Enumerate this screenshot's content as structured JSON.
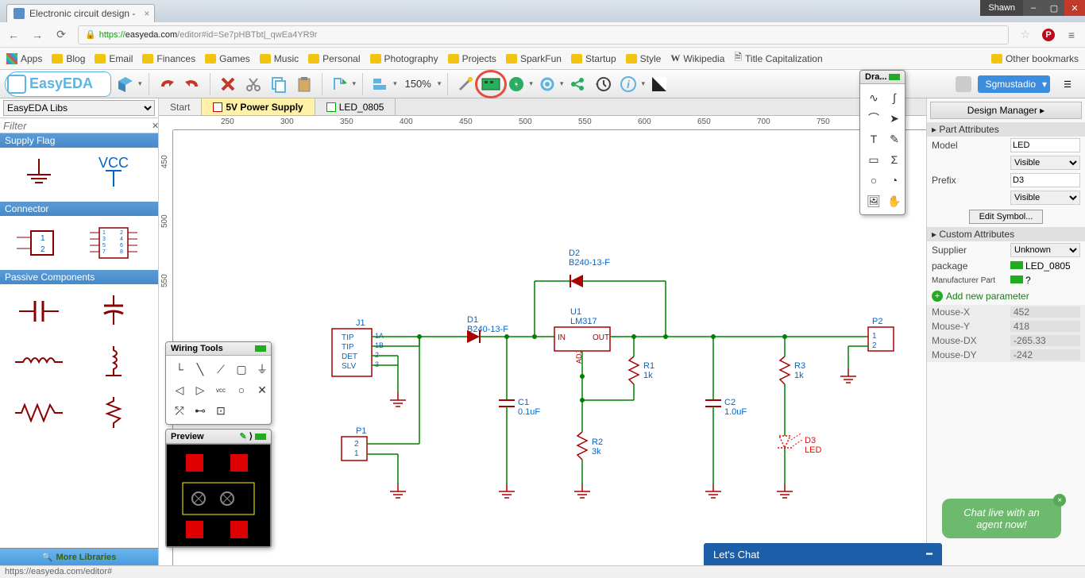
{
  "browser": {
    "tab_title": "Electronic circuit design -",
    "user": "Shawn",
    "url_prefix": "https://",
    "url_host": "easyeda.com",
    "url_path": "/editor#id=Se7pHBTbt|_qwEa4YR9r"
  },
  "bookmarks": {
    "apps": "Apps",
    "items": [
      "Blog",
      "Email",
      "Finances",
      "Games",
      "Music",
      "Personal",
      "Photography",
      "Projects",
      "SparkFun",
      "Startup",
      "Style",
      "Wikipedia",
      "Title Capitalization"
    ],
    "other": "Other bookmarks"
  },
  "toolbar": {
    "zoom": "150%",
    "user": "Sgmustadio"
  },
  "libs": {
    "title": "EasyEDA Libs",
    "filter_placeholder": "Filter",
    "sections": {
      "supply": "Supply Flag",
      "connector": "Connector",
      "passive": "Passive Components"
    },
    "gnd_label": "",
    "vcc_label": "VCC",
    "more": "More Libraries"
  },
  "doc_tabs": {
    "start": "Start",
    "supply": "5V Power Supply",
    "led": "LED_0805"
  },
  "ruler_h": [
    "250",
    "300",
    "350",
    "400",
    "450",
    "500",
    "550",
    "600",
    "650",
    "700",
    "750"
  ],
  "ruler_v": [
    "450",
    "500",
    "550"
  ],
  "schematic": {
    "J1": "J1",
    "J1_pins": [
      "TIP",
      "TIP",
      "DET",
      "SLV"
    ],
    "J1_nums": [
      "1A",
      "1B",
      "2",
      "3"
    ],
    "D1": "D1",
    "D1_val": "B240-13-F",
    "D2": "D2",
    "D2_val": "B240-13-F",
    "U1": "U1",
    "U1_val": "LM317",
    "U1_in": "IN",
    "U1_out": "OUT",
    "U1_adj": "ADJ",
    "C1": "C1",
    "C1_val": "0.1uF",
    "C2": "C2",
    "C2_val": "1.0uF",
    "R1": "R1",
    "R1_val": "1k",
    "R2": "R2",
    "R2_val": "3k",
    "R3": "R3",
    "R3_val": "1k",
    "D3": "D3",
    "D3_val": "LED",
    "P1": "P1",
    "P1_pins": [
      "2",
      "1"
    ],
    "P2": "P2",
    "P2_pins": [
      "1",
      "2"
    ]
  },
  "wiring_tools": {
    "title": "Wiring Tools"
  },
  "drawing_tools": {
    "title": "Dra..."
  },
  "preview": {
    "title": "Preview"
  },
  "rpanel": {
    "design_mgr": "Design Manager ▸",
    "part_attrs": "▸ Part Attributes",
    "model_label": "Model",
    "model_val": "LED",
    "visible1": "Visible",
    "prefix_label": "Prefix",
    "prefix_val": "D3",
    "visible2": "Visible",
    "edit_symbol": "Edit Symbol...",
    "custom_attrs": "▸ Custom Attributes",
    "supplier_label": "Supplier",
    "supplier_val": "Unknown",
    "package_label": "package",
    "package_val": "LED_0805",
    "mfr_label": "Manufacturer Part",
    "mfr_val": "?",
    "add_param": "Add new parameter",
    "mouse_x_l": "Mouse-X",
    "mouse_x": "452",
    "mouse_y_l": "Mouse-Y",
    "mouse_y": "418",
    "mouse_dx_l": "Mouse-DX",
    "mouse_dx": "-265.33",
    "mouse_dy_l": "Mouse-DY",
    "mouse_dy": "-242"
  },
  "chat": {
    "bubble": "Chat live with an agent now!",
    "bar": "Let's Chat"
  },
  "status": "https://easyeda.com/editor#"
}
